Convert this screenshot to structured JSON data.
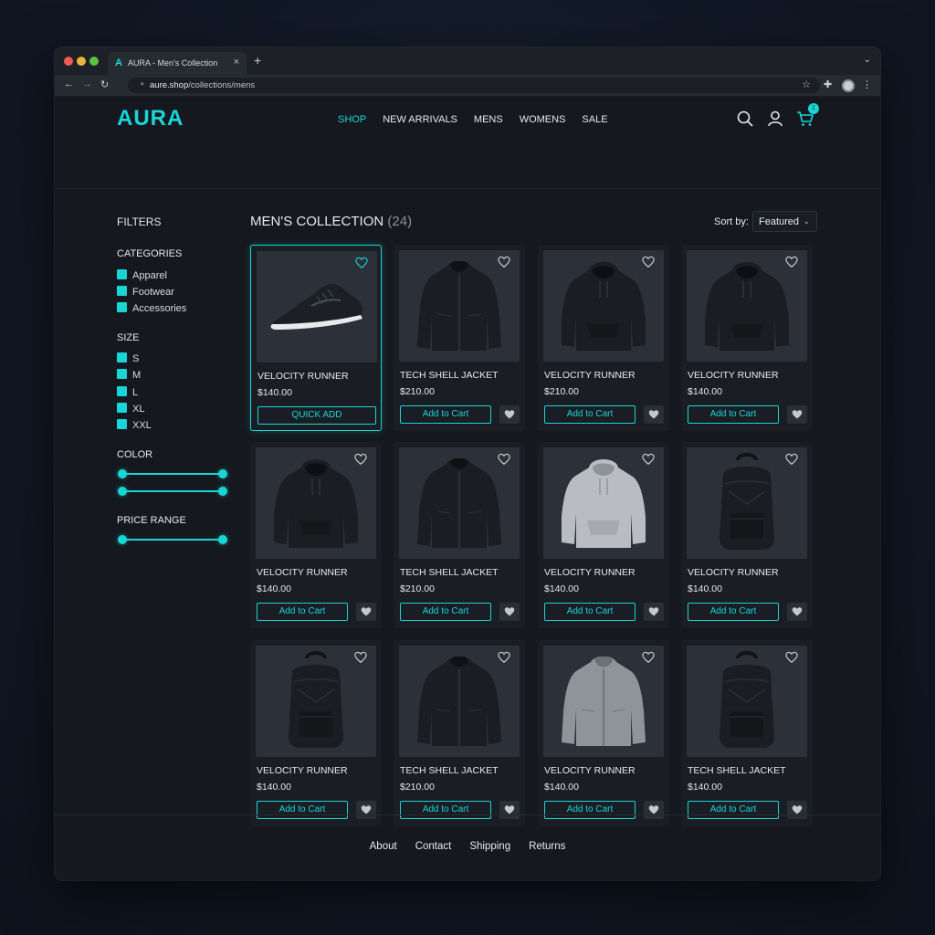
{
  "browser": {
    "tab_logo": "A",
    "tab_title": "AURA - Men's Collection",
    "tab_close": "×",
    "new_tab": "+",
    "url_host": "aure.shop",
    "url_path": "/collections/mens"
  },
  "header": {
    "logo": "AURA",
    "nav": [
      "SHOP",
      "NEW ARRIVALS",
      "MENS",
      "WOMENS",
      "SALE"
    ],
    "active_nav": "SHOP",
    "cart_count": "1"
  },
  "filters": {
    "title": "FILTERS",
    "categories_title": "CATEGORIES",
    "categories": [
      "Apparel",
      "Footwear",
      "Accessories"
    ],
    "size_title": "SIZE",
    "sizes": [
      "S",
      "M",
      "L",
      "XL",
      "XXL"
    ],
    "color_title": "COLOR",
    "price_title": "PRICE RANGE"
  },
  "collection": {
    "title": "MEN'S COLLECTION",
    "count": "(24)",
    "sort_label": "Sort by:",
    "sort_value": "Featured"
  },
  "products": [
    {
      "name": "VELOCITY RUNNER",
      "price": "$140.00",
      "button": "QUICK ADD",
      "image": "shoe"
    },
    {
      "name": "TECH SHELL JACKET",
      "price": "$210.00",
      "button": "Add to Cart",
      "image": "jacket"
    },
    {
      "name": "VELOCITY RUNNER",
      "price": "$210.00",
      "button": "Add to Cart",
      "image": "hoodie"
    },
    {
      "name": "VELOCITY RUNNER",
      "price": "$140.00",
      "button": "Add to Cart",
      "image": "hoodie"
    },
    {
      "name": "VELOCITY RUNNER",
      "price": "$140.00",
      "button": "Add to Cart",
      "image": "hoodie"
    },
    {
      "name": "TECH SHELL JACKET",
      "price": "$210.00",
      "button": "Add to Cart",
      "image": "jacket"
    },
    {
      "name": "VELOCITY RUNNER",
      "price": "$140.00",
      "button": "Add to Cart",
      "image": "hoodie-light"
    },
    {
      "name": "VELOCITY RUNNER",
      "price": "$140.00",
      "button": "Add to Cart",
      "image": "backpack"
    },
    {
      "name": "VELOCITY RUNNER",
      "price": "$140.00",
      "button": "Add to Cart",
      "image": "backpack"
    },
    {
      "name": "TECH SHELL JACKET",
      "price": "$210.00",
      "button": "Add to Cart",
      "image": "jacket"
    },
    {
      "name": "VELOCITY RUNNER",
      "price": "$140.00",
      "button": "Add to Cart",
      "image": "jacket-light"
    },
    {
      "name": "TECH SHELL JACKET",
      "price": "$140.00",
      "button": "Add to Cart",
      "image": "backpack"
    }
  ],
  "footer": {
    "links": [
      "About",
      "Contact",
      "Shipping",
      "Returns"
    ]
  },
  "colors": {
    "accent": "#19d5d6",
    "background": "#15191f",
    "card": "#1a1e24"
  }
}
